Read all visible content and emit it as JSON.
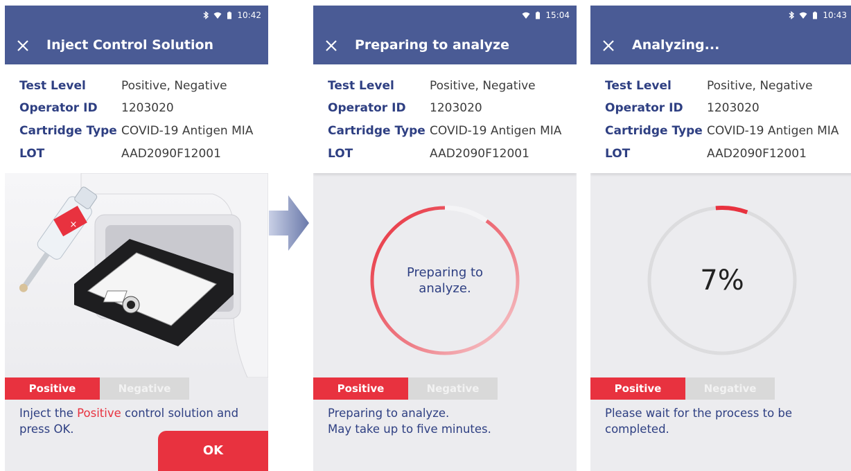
{
  "screens": [
    {
      "status_time": "10:42",
      "title": "Inject Control Solution",
      "info": [
        {
          "label": "Test Level",
          "value": "Positive, Negative"
        },
        {
          "label": "Operator ID",
          "value": "1203020"
        },
        {
          "label": "Cartridge Type",
          "value": "COVID-19 Antigen MIA"
        },
        {
          "label": "LOT",
          "value": "AAD2090F12001"
        }
      ],
      "tabs": {
        "positive": "Positive",
        "negative": "Negative",
        "selected": "Positive"
      },
      "message": {
        "before": "Inject the ",
        "highlight": "Positive",
        "after": " control solution and press OK."
      },
      "ok_label": "OK"
    },
    {
      "status_time": "15:04",
      "title": "Preparing to analyze",
      "info": [
        {
          "label": "Test Level",
          "value": "Positive, Negative"
        },
        {
          "label": "Operator ID",
          "value": "1203020"
        },
        {
          "label": "Cartridge Type",
          "value": "COVID-19 Antigen MIA"
        },
        {
          "label": "LOT",
          "value": "AAD2090F12001"
        }
      ],
      "progress_text_line1": "Preparing to",
      "progress_text_line2": "analyze.",
      "tabs": {
        "positive": "Positive",
        "negative": "Negative",
        "selected": "Positive"
      },
      "message_line1": "Preparing to analyze.",
      "message_line2": "May take up to five minutes."
    },
    {
      "status_time": "10:43",
      "title": "Analyzing...",
      "info": [
        {
          "label": "Test Level",
          "value": "Positive, Negative"
        },
        {
          "label": "Operator ID",
          "value": "1203020"
        },
        {
          "label": "Cartridge Type",
          "value": "COVID-19 Antigen MIA"
        },
        {
          "label": "LOT",
          "value": "AAD2090F12001"
        }
      ],
      "progress_percent_label": "7%",
      "progress_fraction": 0.07,
      "tabs": {
        "positive": "Positive",
        "negative": "Negative",
        "selected": "Positive"
      },
      "message_line1": "Please wait for the process to be",
      "message_line2": "completed."
    }
  ],
  "colors": {
    "header": "#4a5b95",
    "accent_red": "#e8323f",
    "label_blue": "#2e3f82",
    "tab_inactive": "#d9d9d9",
    "screen_bg": "#ececef"
  },
  "icons": [
    "bluetooth-icon",
    "wifi-icon",
    "battery-icon",
    "close-icon",
    "next-arrow-icon"
  ]
}
